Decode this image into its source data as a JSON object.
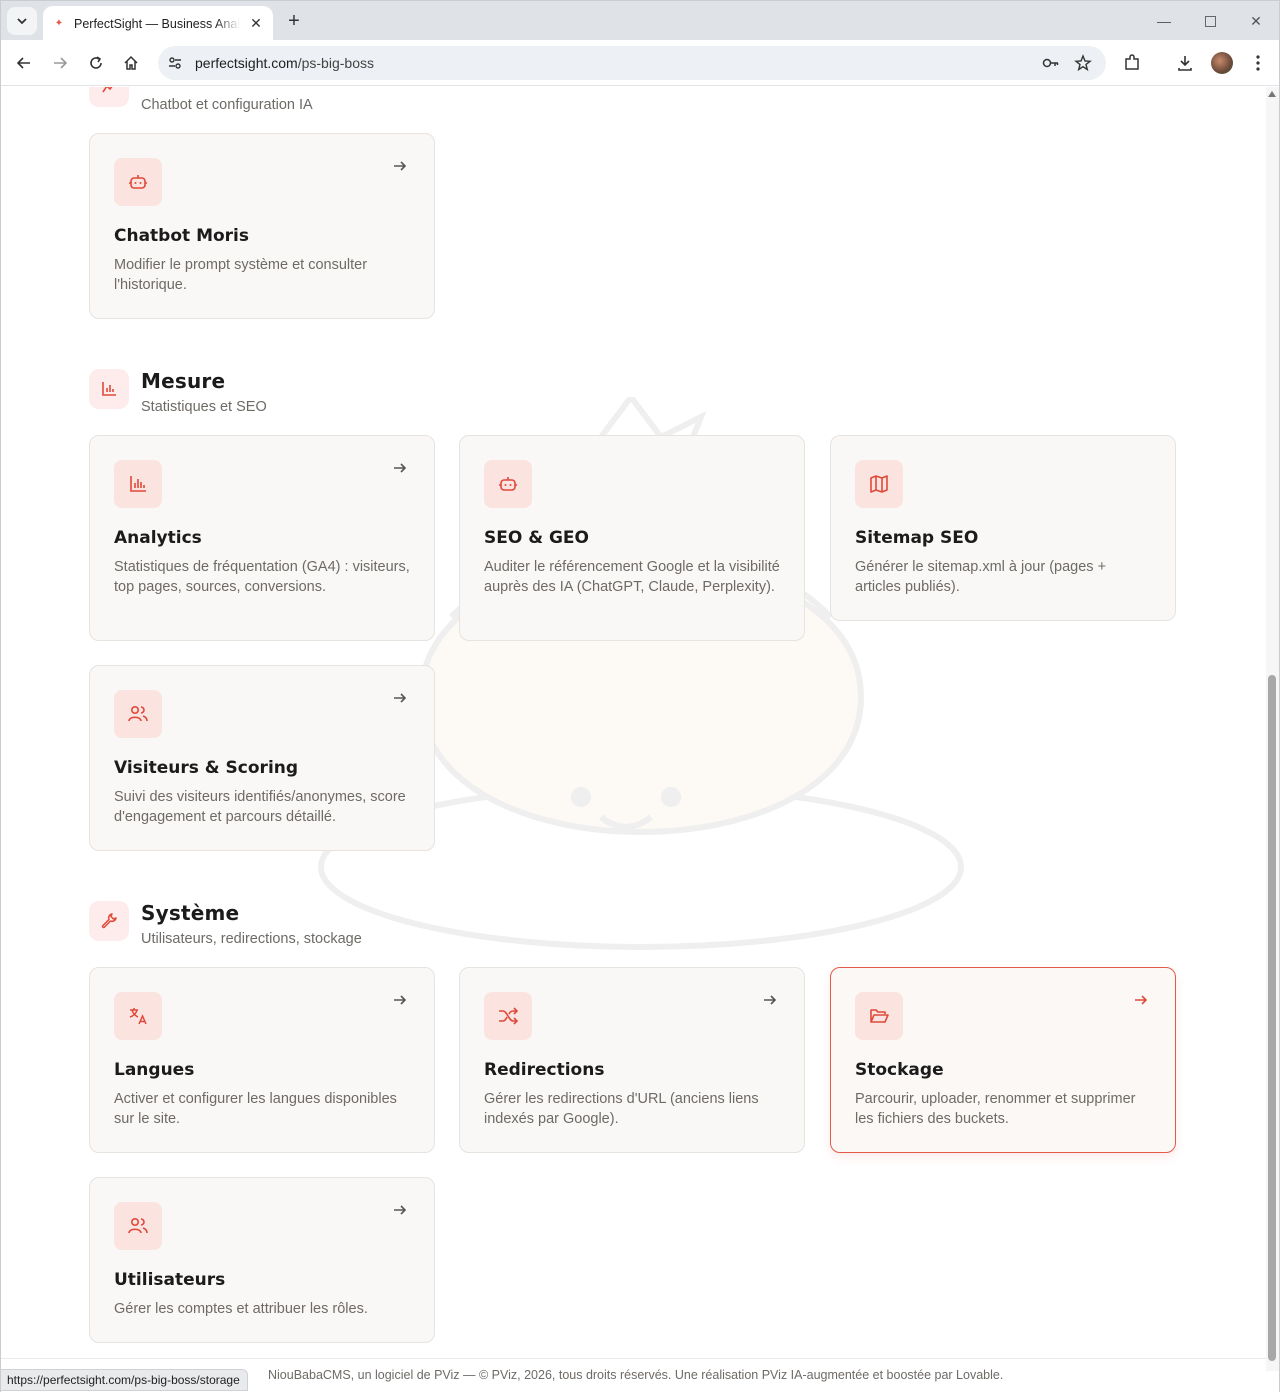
{
  "browser": {
    "tab_title": "PerfectSight — Business Analytics",
    "url_host": "perfectsight.com",
    "url_path": "/ps-big-boss",
    "status_url": "https://perfectsight.com/ps-big-boss/storage"
  },
  "sections": {
    "ia": {
      "subtitle": "Chatbot et configuration IA"
    },
    "mesure": {
      "title": "Mesure",
      "subtitle": "Statistiques et SEO"
    },
    "systeme": {
      "title": "Système",
      "subtitle": "Utilisateurs, redirections, stockage"
    }
  },
  "cards": {
    "chatbot": {
      "title": "Chatbot Moris",
      "desc": "Modifier le prompt système et consulter l'historique.",
      "icon": "bot-icon"
    },
    "analytics": {
      "title": "Analytics",
      "desc": "Statistiques de fréquentation (GA4) : visiteurs, top pages, sources, conversions.",
      "icon": "bar-chart-icon"
    },
    "seo": {
      "title": "SEO & GEO",
      "desc": "Auditer le référencement Google et la visibilité auprès des IA (ChatGPT, Claude, Perplexity).",
      "icon": "bot-icon"
    },
    "sitemap": {
      "title": "Sitemap SEO",
      "desc": "Générer le sitemap.xml à jour (pages + articles publiés).",
      "icon": "map-icon"
    },
    "visiteurs": {
      "title": "Visiteurs & Scoring",
      "desc": "Suivi des visiteurs identifiés/anonymes, score d'engagement et parcours détaillé.",
      "icon": "users-icon"
    },
    "langues": {
      "title": "Langues",
      "desc": "Activer et configurer les langues disponibles sur le site.",
      "icon": "translate-icon"
    },
    "redirections": {
      "title": "Redirections",
      "desc": "Gérer les redirections d'URL (anciens liens indexés par Google).",
      "icon": "shuffle-icon"
    },
    "stockage": {
      "title": "Stockage",
      "desc": "Parcourir, uploader, renommer et supprimer les fichiers des buckets.",
      "icon": "folder-open-icon"
    },
    "utilisateurs": {
      "title": "Utilisateurs",
      "desc": "Gérer les comptes et attribuer les rôles.",
      "icon": "users-icon"
    }
  },
  "footer": {
    "text": "NiouBabaCMS, un logiciel de PViz — © PViz, 2026, tous droits réservés. Une réalisation PViz IA-augmentée et boostée par Lovable."
  },
  "colors": {
    "accent": "#e0493a",
    "card_bg": "#faf8f6",
    "icon_bg": "#fbe3e0"
  }
}
